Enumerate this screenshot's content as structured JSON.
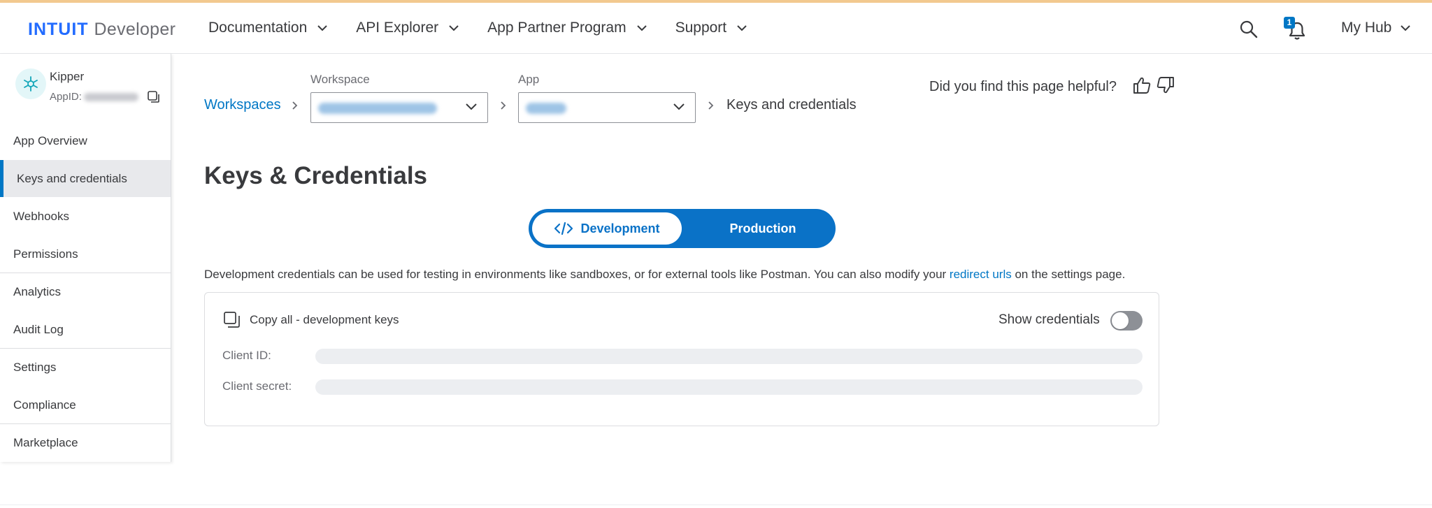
{
  "brand": {
    "logo_primary": "INTUIT",
    "logo_secondary": "Developer"
  },
  "nav": {
    "items": [
      {
        "label": "Documentation"
      },
      {
        "label": "API Explorer"
      },
      {
        "label": "App Partner Program"
      },
      {
        "label": "Support"
      }
    ],
    "notification_count": "1",
    "my_hub": "My Hub"
  },
  "app": {
    "name": "Kipper",
    "id_label": "AppID:"
  },
  "sidebar": {
    "items": [
      {
        "label": "App Overview"
      },
      {
        "label": "Keys and credentials"
      },
      {
        "label": "Webhooks"
      },
      {
        "label": "Permissions"
      },
      {
        "label": "Analytics"
      },
      {
        "label": "Audit Log"
      },
      {
        "label": "Settings"
      },
      {
        "label": "Compliance"
      },
      {
        "label": "Marketplace"
      }
    ],
    "active_index": 1
  },
  "breadcrumb": {
    "root": "Workspaces",
    "workspace_label": "Workspace",
    "app_label": "App",
    "current": "Keys and credentials"
  },
  "feedback": {
    "question": "Did you find this page helpful?"
  },
  "page": {
    "title": "Keys & Credentials",
    "tabs": [
      {
        "label": "Development"
      },
      {
        "label": "Production"
      }
    ],
    "selected_tab": "Development",
    "description_pre": "Development credentials can be used for testing in environments like sandboxes, or for external tools like Postman. You can also modify your ",
    "description_link": "redirect urls",
    "description_post": " on the settings page."
  },
  "credentials": {
    "copy_all": "Copy all - development keys",
    "show_label": "Show credentials",
    "show_enabled": false,
    "client_id_label": "Client ID:",
    "client_secret_label": "Client secret:"
  },
  "colors": {
    "brand_blue": "#236cff",
    "link_blue": "#0077c5",
    "toggle_blue": "#0a72c7"
  }
}
